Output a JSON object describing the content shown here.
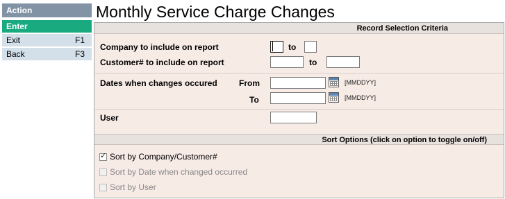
{
  "sidebar": {
    "header": "Action",
    "items": [
      {
        "label": "Enter",
        "key": ""
      },
      {
        "label": "Exit",
        "key": "F1"
      },
      {
        "label": "Back",
        "key": "F3"
      }
    ]
  },
  "page": {
    "title": "Monthly Service Charge Changes"
  },
  "selection": {
    "header": "Record Selection Criteria",
    "company_label": "Company to include on report",
    "customer_label": "Customer# to include on report",
    "to_label": "to",
    "dates_label": "Dates when changes occured",
    "from_label": "From",
    "to_date_label": "To",
    "date_hint": "[MMDDYY]",
    "user_label": "User",
    "values": {
      "company_from": "",
      "company_to": "",
      "customer_from": "",
      "customer_to": "",
      "date_from": "",
      "date_to": "",
      "user": ""
    }
  },
  "sort": {
    "header": "Sort Options (click on option to toggle on/off)",
    "options": [
      {
        "label": "Sort by Company/Customer#",
        "checked": true,
        "enabled": true
      },
      {
        "label": "Sort by Date when changed occurred",
        "checked": false,
        "enabled": false
      },
      {
        "label": "Sort by User",
        "checked": false,
        "enabled": false
      }
    ]
  },
  "colors": {
    "sidebar_header": "#8293a6",
    "active_item": "#19ab7f",
    "item_bg": "#d3dfe9",
    "form_bg": "#f7ebe6"
  },
  "icons": {
    "calendar": "calendar-icon",
    "check": "checkbox-checked-icon"
  }
}
